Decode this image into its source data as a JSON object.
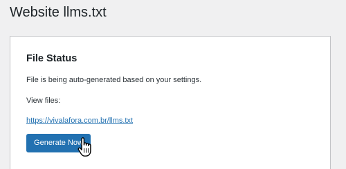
{
  "page": {
    "title": "Website llms.txt"
  },
  "file_status": {
    "title": "File Status",
    "description": "File is being auto-generated based on your settings.",
    "view_label": "View files:",
    "file_link": "https://vivalafora.com.br/llms.txt",
    "generate_button_label": "Generate Now"
  },
  "colors": {
    "accent": "#2271b1",
    "background": "#f0f0f1",
    "card_border": "#c3c4c7"
  },
  "icons": {
    "cursor": "hand-pointer-icon"
  }
}
